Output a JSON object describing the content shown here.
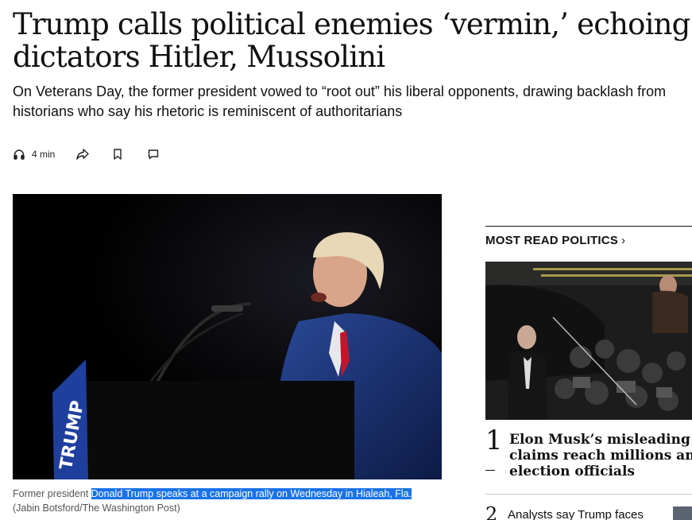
{
  "article": {
    "headline_line1": "Trump calls political enemies ‘vermin,’ echoing",
    "headline_line2": "dictators Hitler, Mussolini",
    "dek_line1": "On Veterans Day, the former president vowed to “root out” his liberal opponents, drawing backlash from",
    "dek_line2": "historians who say his rhetoric is reminiscent of authoritarians"
  },
  "toolbar": {
    "listen_time": "4 min",
    "icons": [
      "headphones-icon",
      "share-icon",
      "bookmark-icon",
      "comment-icon"
    ]
  },
  "hero_image": {
    "sign_text": "TRUMP"
  },
  "caption": {
    "prefix": "Former president ",
    "highlighted": "Donald Trump speaks at a campaign rally on Wednesday in Hialeah, Fla.",
    "credit": "(Jabin Botsford/The Washington Post)",
    "highlight_color": "#1a73e8"
  },
  "rail": {
    "title": "MOST READ POLITICS",
    "chevron": "›",
    "stories": [
      {
        "number": "1",
        "lines": [
          "Elon Musk’s misleading elec",
          "claims reach millions and a",
          "election officials"
        ]
      },
      {
        "number": "2",
        "title": "Analysts say Trump faces"
      }
    ]
  }
}
